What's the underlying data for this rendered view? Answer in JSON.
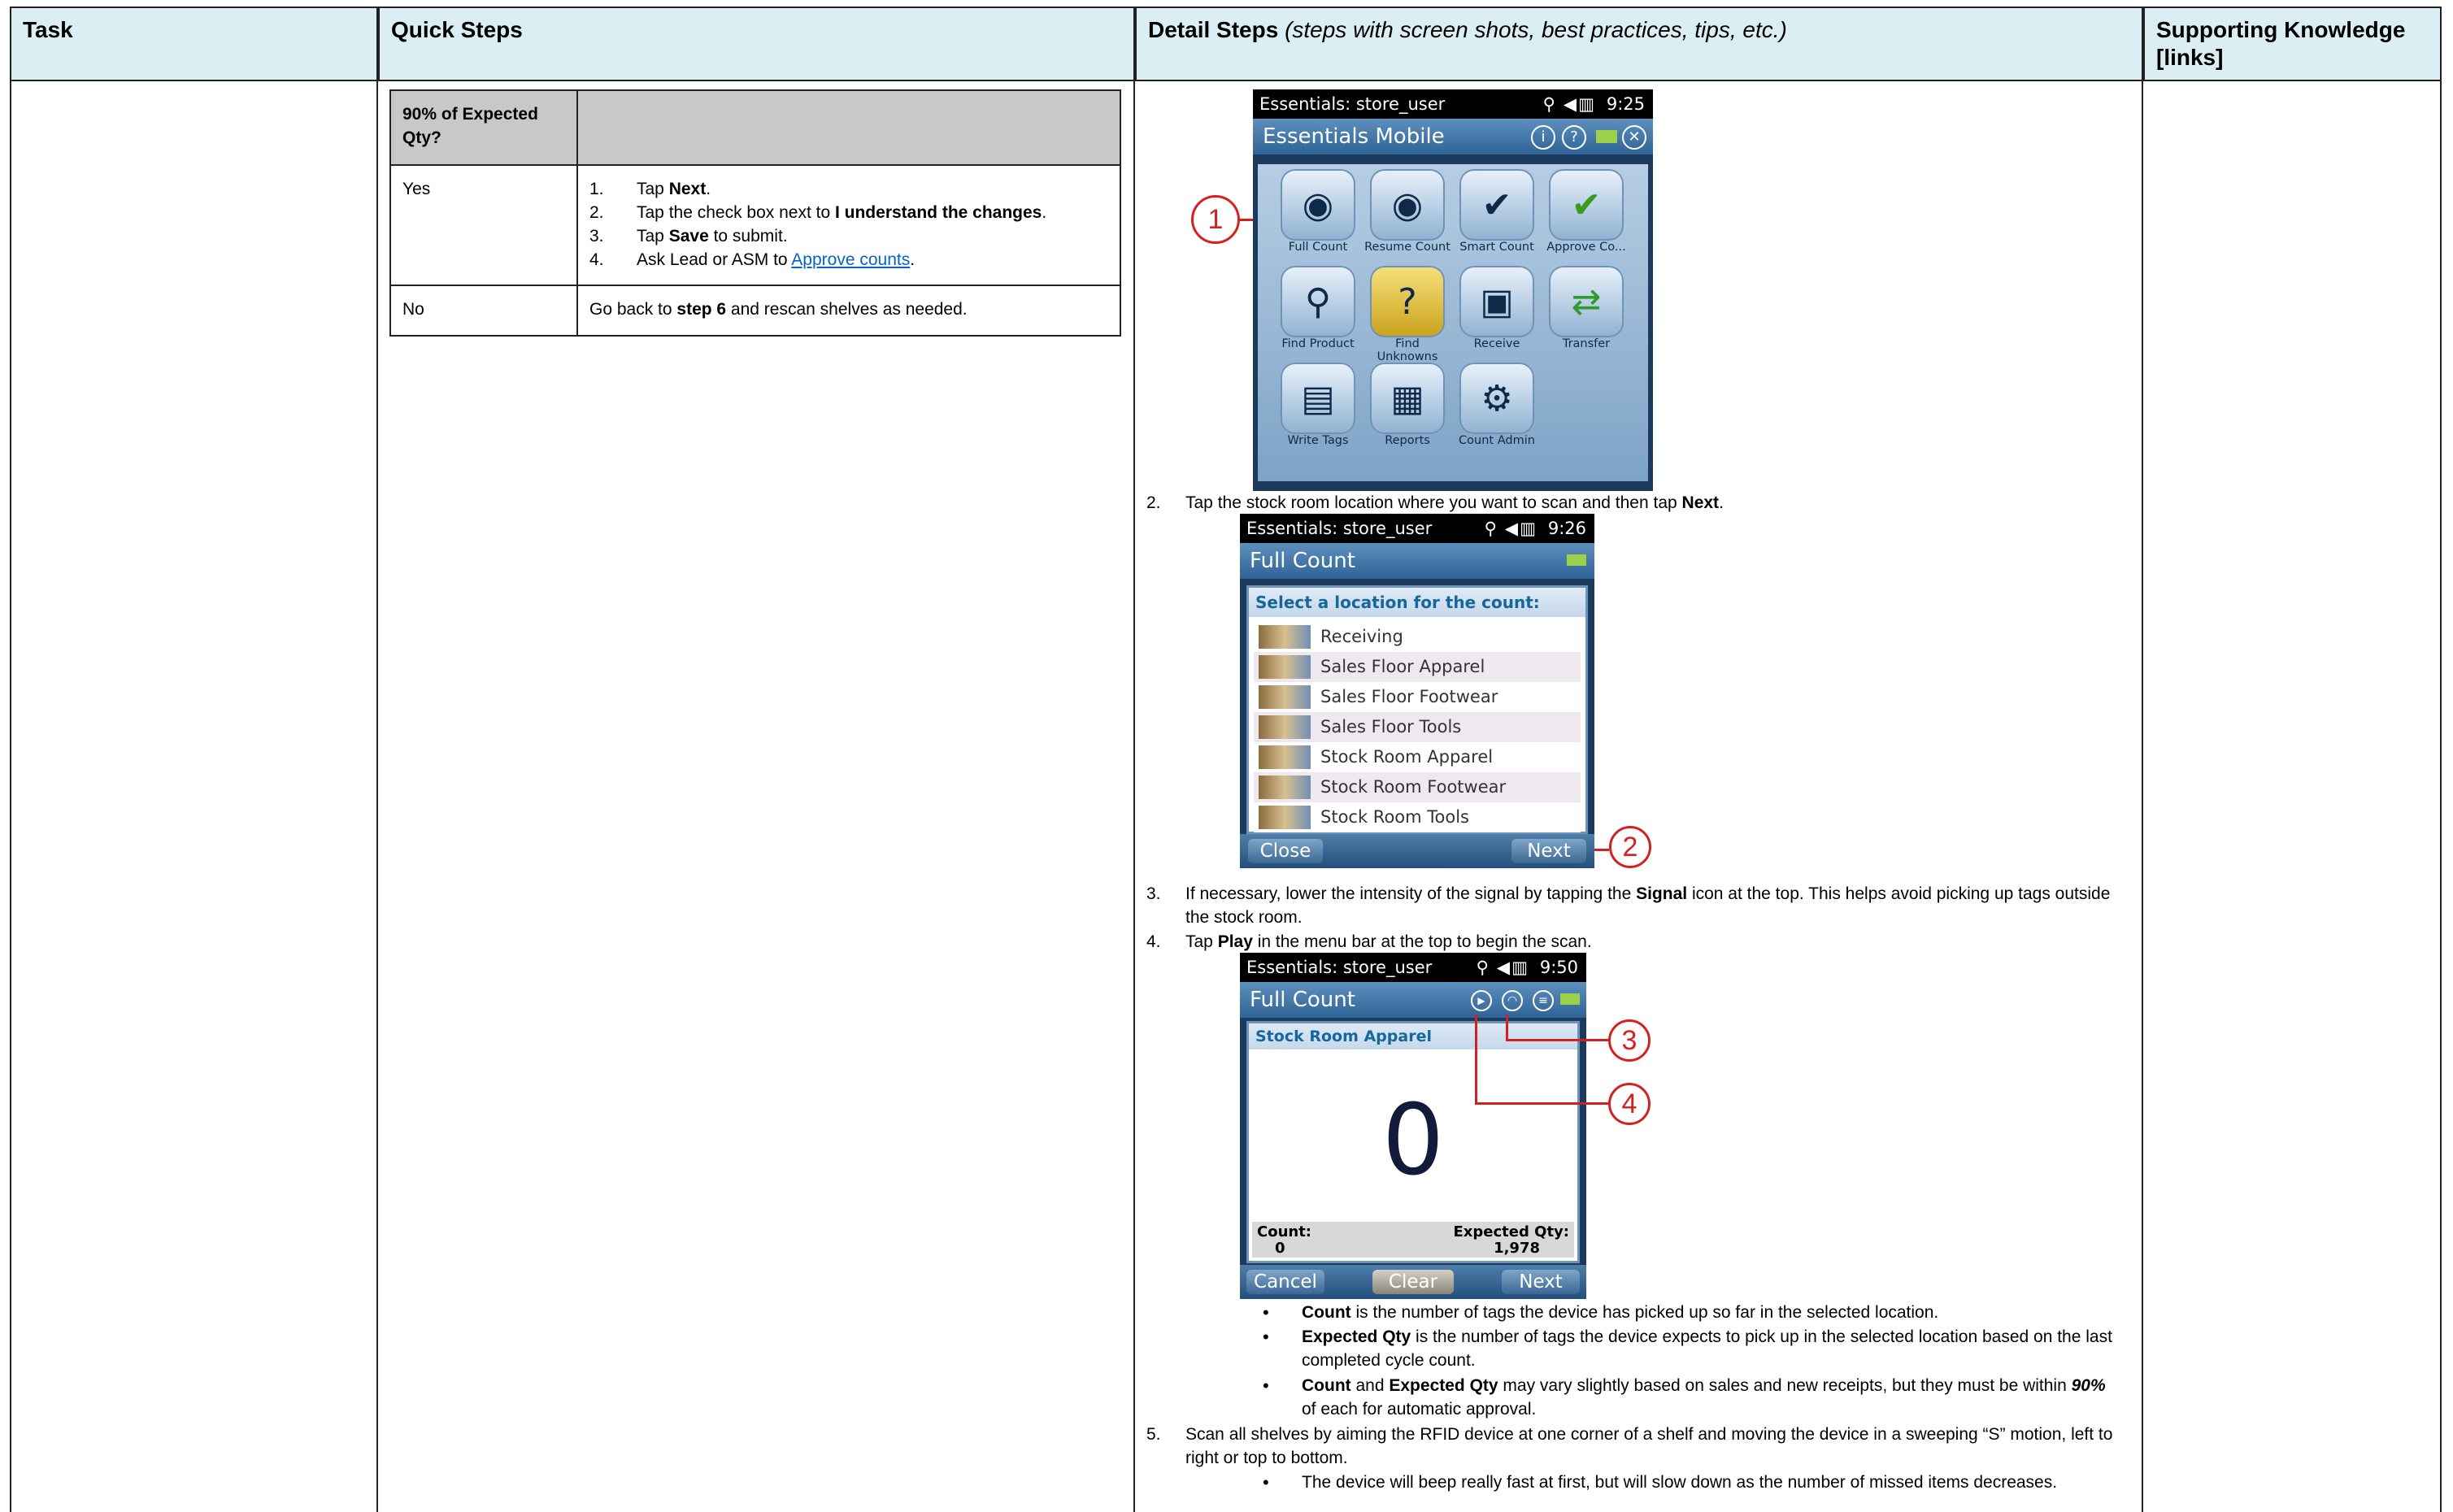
{
  "table": {
    "headers": {
      "task": "Task",
      "quick": "Quick Steps",
      "detail": "Detail Steps",
      "detail_note": "(steps with screen shots, best practices, tips, etc.)",
      "support": "Supporting Knowledge [links]"
    }
  },
  "quick_table": {
    "header": "90% of Expected Qty?",
    "rows": [
      {
        "answer": "Yes",
        "steps": [
          {
            "num": "1.",
            "pre": "Tap ",
            "bold": "Next",
            "post": "."
          },
          {
            "num": "2.",
            "pre": "Tap the check box next to ",
            "bold": "I understand the changes",
            "post": "."
          },
          {
            "num": "3.",
            "pre": "Tap ",
            "bold": "Save",
            "post": " to submit."
          },
          {
            "num": "4.",
            "pre": "Ask Lead or ASM to ",
            "link": "Approve counts",
            "post": "."
          }
        ]
      },
      {
        "answer": "No",
        "pre": "Go back to ",
        "bold": "step 6",
        "post": " and rescan shelves as needed."
      }
    ]
  },
  "phone1": {
    "status_title": "Essentials: store_user",
    "time": "9:25",
    "title": "Essentials Mobile",
    "tiles": [
      "Full Count",
      "Resume Count",
      "Smart Count",
      "Approve Co...",
      "Find Product",
      "Find Unknowns",
      "Receive",
      "Transfer",
      "Write Tags",
      "Reports",
      "Count Admin"
    ],
    "callout": "1"
  },
  "step2": {
    "num": "2.",
    "pre": "Tap the stock room location where you want to scan and then tap ",
    "bold": "Next",
    "post": "."
  },
  "phone2": {
    "status_title": "Essentials: store_user",
    "time": "9:26",
    "title": "Full Count",
    "prompt": "Select a location for the count:",
    "locations": [
      "Receiving",
      "Sales Floor Apparel",
      "Sales Floor Footwear",
      "Sales Floor Tools",
      "Stock Room Apparel",
      "Stock Room Footwear",
      "Stock Room Tools"
    ],
    "close": "Close",
    "next": "Next",
    "callout": "2"
  },
  "step3": {
    "num": "3.",
    "pre": "If necessary, lower the intensity of the signal by tapping the ",
    "bold": "Signal",
    "post": " icon at the top. This helps avoid picking up tags outside the stock room."
  },
  "step4": {
    "num": "4.",
    "pre": "Tap ",
    "bold": "Play",
    "post": " in the menu bar at the top to begin the scan."
  },
  "phone3": {
    "status_title": "Essentials: store_user",
    "time": "9:50",
    "title": "Full Count",
    "location": "Stock Room Apparel",
    "big_count": "0",
    "count_label": "Count:",
    "count_value": "0",
    "expected_label": "Expected Qty:",
    "expected_value": "1,978",
    "cancel": "Cancel",
    "clear": "Clear",
    "next": "Next",
    "callout3": "3",
    "callout4": "4"
  },
  "bullets": [
    {
      "bold": "Count",
      "post": " is the number of tags the device has picked up so far in the selected location."
    },
    {
      "bold": "Expected Qty",
      "post": " is the number of tags the device expects to pick up in the selected location based on the last completed cycle count."
    },
    {
      "bold": "Count",
      "mid": " and ",
      "bold2": "Expected Qty",
      "post": " may vary slightly based on sales and new receipts, but they must be within ",
      "bolditalic": "90%",
      "post2": " of each for automatic approval."
    }
  ],
  "step5": {
    "num": "5.",
    "text": "Scan all shelves by aiming the RFID device at one corner of a shelf and moving the device in a sweeping “S” motion, left to right or top to bottom."
  },
  "bullet5": "The device will beep really fast at first, but will slow down as the number of missed items decreases."
}
